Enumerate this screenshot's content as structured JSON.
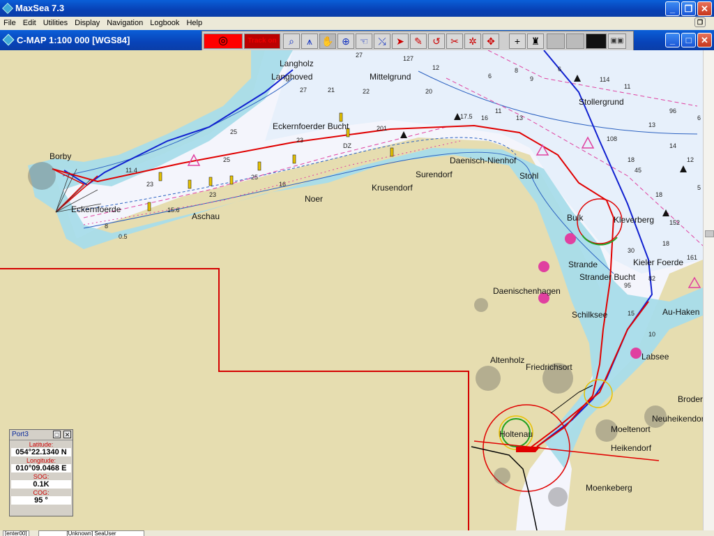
{
  "app": {
    "title": "MaxSea 7.3"
  },
  "menu": [
    "File",
    "Edit",
    "Utilities",
    "Display",
    "Navigation",
    "Logbook",
    "Help"
  ],
  "chart_window": {
    "title": "C-MAP  1:100 000 [WGS84]"
  },
  "toolbar": {
    "track_label": "Track on"
  },
  "places": [
    "Langholz",
    "Langhoved",
    "Mittelgrund",
    "Eckernfoerder Bucht",
    "Borby",
    "Eckernfoerde",
    "Aschau",
    "Noer",
    "Krusendorf",
    "Surendorf",
    "Daenisch-Nienhof",
    "Stohl",
    "Stollergrund",
    "Bulk",
    "Kleverberg",
    "Strande",
    "Strander Bucht",
    "Kieler Foerde",
    "Daenischenhagen",
    "Schilksee",
    "Au-Haken",
    "Altenholz",
    "Friedrichsort",
    "Labsee",
    "Brodersdorf",
    "Neuheikendorf",
    "Moeltenort",
    "Heikendorf",
    "Holtenau",
    "Moenkeberg"
  ],
  "port_panel": {
    "title": "Port3",
    "latitude_label": "Latitude:",
    "latitude": "054°22.1340 N",
    "longitude_label": "Longitude:",
    "longitude": "010°09.0468 E",
    "sog_label": "SOG:",
    "sog": "0.1K",
    "cog_label": "COG:",
    "cog": "95 °"
  },
  "statusbar": {
    "left": "[enter00]",
    "user": "[Unknown] SeaUser"
  },
  "colors": {
    "route": "#e00000",
    "track": "#1020d0",
    "land": "#e6ddb0",
    "shallow": "#a8dcea",
    "deep": "#f4f5fc"
  }
}
